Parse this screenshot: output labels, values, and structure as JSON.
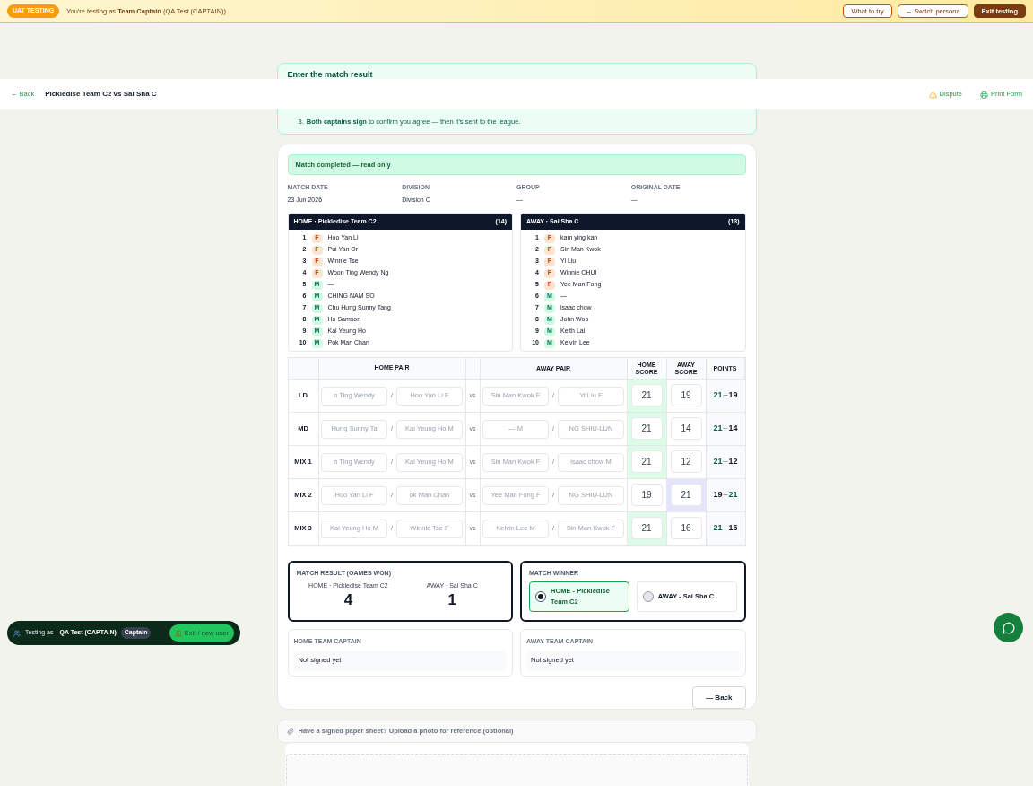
{
  "banner": {
    "badge": "UAT TESTING",
    "message": "You're testing as **Team Captain** (QA Test (CAPTAIN))",
    "buttons": [
      {
        "label": "What to try",
        "kind": "outline"
      },
      {
        "label": "← Switch persona",
        "kind": "outline"
      },
      {
        "label": "Exit testing",
        "kind": "solid"
      }
    ]
  },
  "instructions": {
    "title": "Enter the match result",
    "steps": [
      {
        "number": "3.",
        "text": "**Both captains sign** to confirm you agree — then it's sent to the league."
      }
    ]
  },
  "header": {
    "back": "← Back",
    "title": "Pickledise Team C2 vs Sai Sha C",
    "actions": [
      {
        "label": "Dispute",
        "kind": "warning"
      },
      {
        "label": "Print Form",
        "kind": "print"
      }
    ]
  },
  "status": "Match completed — read only",
  "meta": [
    {
      "label": "MATCH DATE",
      "value": "23 Jun 2026"
    },
    {
      "label": "DIVISION",
      "value": "Division C"
    },
    {
      "label": "GROUP",
      "value": "—"
    },
    {
      "label": "ORIGINAL DATE",
      "value": "—"
    }
  ],
  "rosters": [
    {
      "title": "HOME · Pickledise Team C2",
      "count": "(14)",
      "players": [
        {
          "number": "1",
          "kind": "female",
          "tag": "F",
          "name": "Hoo Yan Li"
        },
        {
          "number": "2",
          "kind": "female",
          "tag": "F",
          "name": "Pui Yan Or"
        },
        {
          "number": "3",
          "kind": "female",
          "tag": "F",
          "name": "Winnie Tse"
        },
        {
          "number": "4",
          "kind": "female",
          "tag": "F",
          "name": "Woon Ting Wendy Ng"
        },
        {
          "number": "5",
          "kind": "male",
          "tag": "M",
          "name": "—"
        },
        {
          "number": "6",
          "kind": "male",
          "tag": "M",
          "name": "CHING NAM SO"
        },
        {
          "number": "7",
          "kind": "male",
          "tag": "M",
          "name": "Chu Hung Sunny Tang"
        },
        {
          "number": "8",
          "kind": "male",
          "tag": "M",
          "name": "Ho Samson"
        },
        {
          "number": "9",
          "kind": "male",
          "tag": "M",
          "name": "Kai Yeung Ho"
        },
        {
          "number": "10",
          "kind": "male",
          "tag": "M",
          "name": "Pok Man Chan"
        }
      ]
    },
    {
      "title": "AWAY · Sai Sha C",
      "count": "(13)",
      "players": [
        {
          "number": "1",
          "kind": "female",
          "tag": "F",
          "name": "kam ying kan"
        },
        {
          "number": "2",
          "kind": "female",
          "tag": "F",
          "name": "Sin Man Kwok"
        },
        {
          "number": "3",
          "kind": "female",
          "tag": "F",
          "name": "Yi Liu"
        },
        {
          "number": "4",
          "kind": "female",
          "tag": "F",
          "name": "Winnie CHUI"
        },
        {
          "number": "5",
          "kind": "female",
          "tag": "F",
          "name": "Yee Man Fong"
        },
        {
          "number": "6",
          "kind": "male",
          "tag": "M",
          "name": "—"
        },
        {
          "number": "7",
          "kind": "male",
          "tag": "M",
          "name": "isaac chow"
        },
        {
          "number": "8",
          "kind": "male",
          "tag": "M",
          "name": "John Woo"
        },
        {
          "number": "9",
          "kind": "male",
          "tag": "M",
          "name": "Keith Lai"
        },
        {
          "number": "10",
          "kind": "male",
          "tag": "M",
          "name": "Kelvin Lee"
        }
      ]
    }
  ],
  "games": {
    "columns": [
      "HOME PAIR",
      "AWAY PAIR",
      "HOME SCORE",
      "AWAY SCORE",
      "POINTS"
    ],
    "rows": [
      {
        "label": "LD",
        "home_pair": {
          "first": "n Ting Wendy",
          "sep": "/",
          "second": "Hoo Yan Li F"
        },
        "vs": "vs",
        "away_pair": {
          "first": "Sin Man Kwok F",
          "sep": "/",
          "second": "Yi Liu F"
        },
        "home_score": "21",
        "away_score": "19",
        "home_won": true,
        "points": {
          "home": "21",
          "dash": "–",
          "away": "19"
        }
      },
      {
        "label": "MD",
        "home_pair": {
          "first": "Hung Sunny Ta",
          "sep": "/",
          "second": "Kai Yeung Ho M"
        },
        "vs": "vs",
        "away_pair": {
          "first": "— M",
          "sep": "/",
          "second": "NG SHIU-LUN"
        },
        "home_score": "21",
        "away_score": "14",
        "home_won": true,
        "points": {
          "home": "21",
          "dash": "–",
          "away": "14"
        }
      },
      {
        "label": "MIX 1",
        "home_pair": {
          "first": "n Ting Wendy",
          "sep": "/",
          "second": "Kai Yeung Ho M"
        },
        "vs": "vs",
        "away_pair": {
          "first": "Sin Man Kwok F",
          "sep": "/",
          "second": "isaac chow M"
        },
        "home_score": "21",
        "away_score": "12",
        "home_won": true,
        "points": {
          "home": "21",
          "dash": "–",
          "away": "12"
        }
      },
      {
        "label": "MIX 2",
        "home_pair": {
          "first": "Hoo Yan Li F",
          "sep": "/",
          "second": "ok Man Chan"
        },
        "vs": "vs",
        "away_pair": {
          "first": "Yee Man Fong F",
          "sep": "/",
          "second": "NG SHIU-LUN"
        },
        "home_score": "19",
        "away_score": "21",
        "home_won": false,
        "points": {
          "home": "19",
          "dash": "–",
          "away": "21"
        }
      },
      {
        "label": "MIX 3",
        "home_pair": {
          "first": "Kai Yeung Ho M",
          "sep": "/",
          "second": "Winnie Tse F"
        },
        "vs": "vs",
        "away_pair": {
          "first": "Kelvin Lee M",
          "sep": "/",
          "second": "Sin Man Kwok F"
        },
        "home_score": "21",
        "away_score": "16",
        "home_won": true,
        "points": {
          "home": "21",
          "dash": "–",
          "away": "16"
        }
      }
    ]
  },
  "result": {
    "label": "MATCH RESULT (GAMES WON)",
    "sides": [
      {
        "team": "HOME · Pickledise Team C2",
        "games": "4"
      },
      {
        "team": "AWAY · Sai Sha C",
        "games": "1"
      }
    ]
  },
  "winner": {
    "label": "MATCH WINNER",
    "options": [
      {
        "label": "HOME - Pickledise Team C2",
        "selected": true
      },
      {
        "label": "AWAY - Sai Sha C",
        "selected": false
      }
    ]
  },
  "captains": [
    {
      "label": "HOME TEAM CAPTAIN",
      "status": "Not signed yet"
    },
    {
      "label": "AWAY TEAM CAPTAIN",
      "status": "Not signed yet"
    }
  ],
  "back_button": "— Back",
  "upload": {
    "text": "Have a signed paper sheet? Upload a photo for reference (optional)"
  },
  "persona": {
    "prefix": "Testing as",
    "name": "QA Test (CAPTAIN)",
    "role": "Captain",
    "exit": "Exit / new user"
  }
}
